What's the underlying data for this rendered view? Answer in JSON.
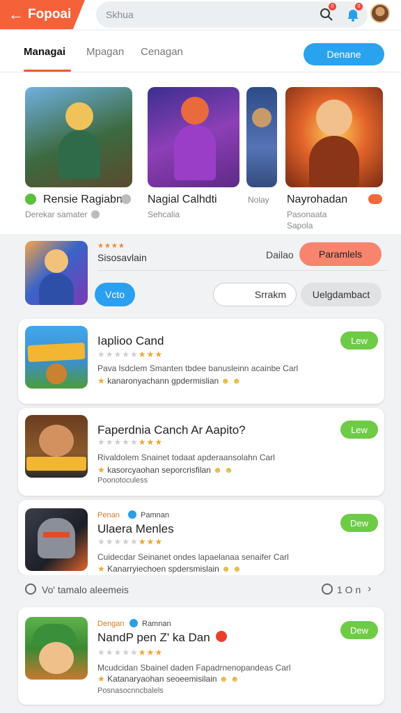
{
  "brand": {
    "back_icon": "arrow-left-icon",
    "name": "Fopoai",
    "color": "#f5623a"
  },
  "search": {
    "placeholder": "Skhua"
  },
  "header_icons": {
    "search_icon": "search-icon",
    "bell_icon": "bell-icon",
    "search_badge": "0",
    "bell_badge": "0"
  },
  "tabs": [
    {
      "label": "Managai",
      "active": true
    },
    {
      "label": "Mpagan",
      "active": false
    },
    {
      "label": "Cenagan",
      "active": false
    }
  ],
  "header_button": "Denane",
  "featured": [
    {
      "title": "Rensie Ragiabn",
      "subtitle": "Derekar samater"
    },
    {
      "title": "Nagial Calhdti",
      "subtitle": "Sehcalia"
    },
    {
      "title": "Nolay",
      "subtitle": ""
    },
    {
      "title": "Nayrohadan",
      "subtitle": "Pasonaata",
      "subtitle2": "Sapola"
    }
  ],
  "promo": {
    "title": "Sisosavlain",
    "rating_text": "★★★★",
    "link": "Dailao",
    "primary_button": "Paramlels",
    "vote_button": "Vcto",
    "outline_button": "Srrakm",
    "gray_button": "Uelgdambact"
  },
  "cards": [
    {
      "title": "Iaplioo Cand",
      "stars_on": 3,
      "stars_total": 8,
      "desc": "Pava lsdclem Smanten tbdee banusleinn acainbe Carl",
      "desc2": "kanaronyachann gpdermislian",
      "action": "Lew"
    },
    {
      "title": "Faperdnia Canch Ar Aapito?",
      "stars_on": 3,
      "stars_total": 8,
      "desc": "Rivaldolem Snainet todaat apderaansolahn Carl",
      "desc2": "kasorcyaohan seporcrisfilan",
      "desc3": "Poonotoculess",
      "action": "Lew"
    },
    {
      "tag": "Penan",
      "tag2": "Pamnan",
      "title": "Ulaera Menles",
      "stars_on": 3,
      "stars_total": 8,
      "desc": "Cuidecdar Seinanet ondes lapaelanaa senaifer Carl",
      "desc2": "Kanarryiechoen spdersmislain",
      "action": "Dew"
    },
    {
      "tag": "Dengan",
      "tag2": "Ramnan",
      "title": "NandP pen Z' ka Dan",
      "stars_on": 3,
      "stars_total": 8,
      "desc": "Mcudcidan Sbainel daden Fapadrnenopandeas Carl",
      "desc2": "Katanaryaohan seoeemisilain",
      "desc3": "Posnasocnncbalels",
      "action": "Dew"
    }
  ],
  "pager": {
    "left_label": "Vo' tamalo aleemeis",
    "right_label": "1 O n"
  }
}
